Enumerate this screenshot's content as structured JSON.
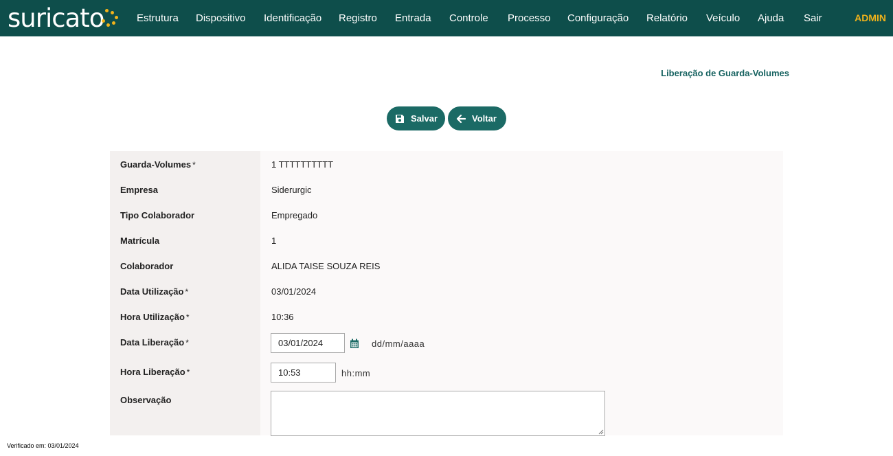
{
  "app": {
    "logo_text": "suricato",
    "logo_color": "#f2b31a",
    "topbar_color": "#0e4e4b"
  },
  "nav": {
    "items": [
      "Estrutura",
      "Dispositivo",
      "Identificação",
      "Registro",
      "Entrada",
      "Controle",
      "Processo",
      "Configuração",
      "Relatório",
      "Veículo",
      "Ajuda",
      "Sair"
    ],
    "user": "ADMIN"
  },
  "page": {
    "title": "Liberação de Guarda-Volumes"
  },
  "actions": {
    "save_label": "Salvar",
    "back_label": "Voltar"
  },
  "form": {
    "guarda_volumes": {
      "label": "Guarda-Volumes",
      "required": "*",
      "value": "1 TTTTTTTTTT"
    },
    "empresa": {
      "label": "Empresa",
      "value": "Siderurgic"
    },
    "tipo_colaborador": {
      "label": "Tipo Colaborador",
      "value": "Empregado"
    },
    "matricula": {
      "label": "Matrícula",
      "value": "1"
    },
    "colaborador": {
      "label": "Colaborador",
      "value": "ALIDA TAISE SOUZA REIS"
    },
    "data_utilizacao": {
      "label": "Data Utilização",
      "required": "*",
      "value": "03/01/2024"
    },
    "hora_utilizacao": {
      "label": "Hora Utilização",
      "required": "*",
      "value": "10:36"
    },
    "data_liberacao": {
      "label": "Data Liberação",
      "required": "*",
      "value": "03/01/2024",
      "hint": "dd/mm/aaaa"
    },
    "hora_liberacao": {
      "label": "Hora Liberação",
      "required": "*",
      "value": "10:53",
      "hint": "hh:mm"
    },
    "observacao": {
      "label": "Observação",
      "value": ""
    }
  },
  "footer": {
    "verified": "Verificado em: 03/01/2024"
  }
}
